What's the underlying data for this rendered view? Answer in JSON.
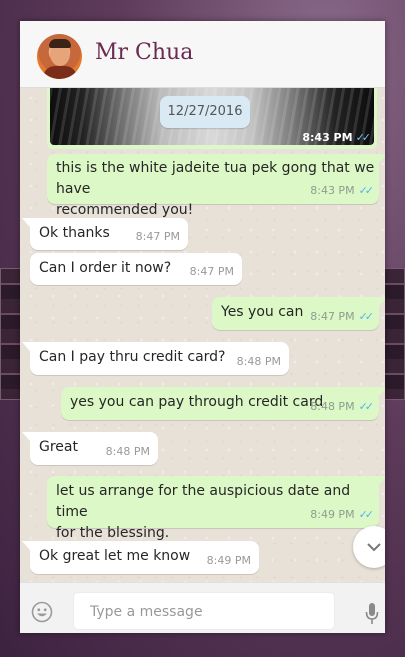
{
  "contact": {
    "name": "Mr Chua"
  },
  "date_chip": "12/27/2016",
  "image_message": {
    "time": "8:43 PM",
    "ticks": "✓✓"
  },
  "messages": [
    {
      "dir": "out",
      "text": "this is the white jadeite tua pek gong that we have recommended you!",
      "line1": "this is the white jadeite tua pek gong that we have",
      "line2": "recommended you!",
      "time": "8:43 PM",
      "ticks": "✓✓"
    },
    {
      "dir": "in",
      "text": "Ok thanks",
      "time": "8:47 PM"
    },
    {
      "dir": "in",
      "text": "Can I order it now?",
      "time": "8:47 PM"
    },
    {
      "dir": "out",
      "text": "Yes you can",
      "time": "8:47 PM",
      "ticks": "✓✓"
    },
    {
      "dir": "in",
      "text": "Can I pay thru credit card?",
      "time": "8:48 PM"
    },
    {
      "dir": "out",
      "text": "yes you can pay through credit card",
      "time": "8:48 PM",
      "ticks": "✓✓"
    },
    {
      "dir": "in",
      "text": "Great",
      "time": "8:48 PM"
    },
    {
      "dir": "out",
      "text": "let us arrange for the auspicious date and time for the blessing.",
      "line1": "let us arrange for the auspicious date and time",
      "line2": "for the blessing.",
      "time": "8:49 PM",
      "ticks": "✓✓"
    },
    {
      "dir": "in",
      "text": "Ok great let me know",
      "time": "8:49 PM"
    }
  ],
  "composer": {
    "placeholder": "Type a message"
  },
  "icons": {
    "emoji": "emoji-icon",
    "mic": "mic-icon",
    "scroll": "chevron-down-icon"
  }
}
